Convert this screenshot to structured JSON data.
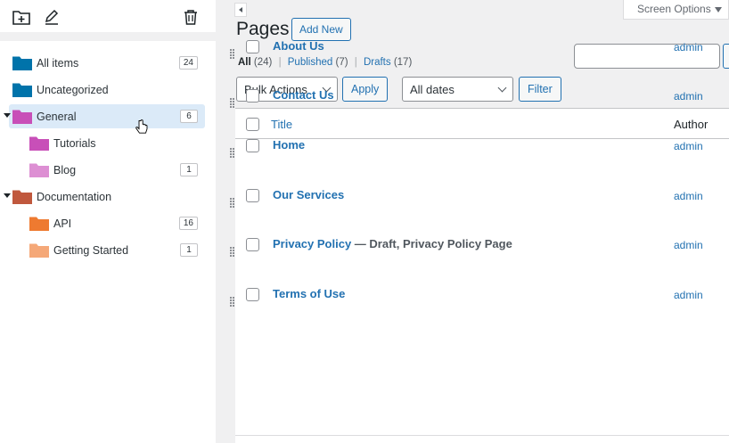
{
  "sidebar": {
    "toolbar": {
      "new_folder_icon": "folder-plus-icon",
      "rename_icon": "pencil-icon",
      "delete_icon": "trash-icon"
    },
    "items": [
      {
        "label": "All items",
        "count": "24",
        "color": "#0073aa",
        "level": 0
      },
      {
        "label": "Uncategorized",
        "count": "",
        "color": "#0073aa",
        "level": 0
      },
      {
        "label": "General",
        "count": "6",
        "color": "#c84fb8",
        "level": 0,
        "expanded": true,
        "selected": true
      },
      {
        "label": "Tutorials",
        "count": "",
        "color": "#c84fb8",
        "level": 1
      },
      {
        "label": "Blog",
        "count": "1",
        "color": "#dd8fd3",
        "level": 1
      },
      {
        "label": "Documentation",
        "count": "",
        "color": "#c0583d",
        "level": 0,
        "expanded": true
      },
      {
        "label": "API",
        "count": "16",
        "color": "#ee7a30",
        "level": 1
      },
      {
        "label": "Getting Started",
        "count": "1",
        "color": "#f5a878",
        "level": 1
      }
    ]
  },
  "header": {
    "screen_options": "Screen Options",
    "title": "Pages",
    "add_new": "Add New"
  },
  "filters": {
    "all": "All",
    "all_count": "(24)",
    "published": "Published",
    "published_count": "(7)",
    "drafts": "Drafts",
    "drafts_count": "(17)",
    "separator": "|"
  },
  "controls": {
    "bulk_actions": "Bulk Actions",
    "apply": "Apply",
    "dates": "All dates",
    "filter": "Filter"
  },
  "table": {
    "columns": {
      "title": "Title",
      "author": "Author"
    },
    "rows": [
      {
        "title": "About Us",
        "state": "",
        "author": "admin"
      },
      {
        "title": "Contact Us",
        "state": "",
        "author": "admin"
      },
      {
        "title": "Home",
        "state": "",
        "author": "admin"
      },
      {
        "title": "Our Services",
        "state": "",
        "author": "admin"
      },
      {
        "title": "Privacy Policy",
        "state": " — Draft, Privacy Policy Page",
        "author": "admin"
      },
      {
        "title": "Terms of Use",
        "state": "",
        "author": "admin"
      }
    ]
  },
  "colors": {
    "link": "#2271b1",
    "selected_row": "#dbeaf8"
  }
}
